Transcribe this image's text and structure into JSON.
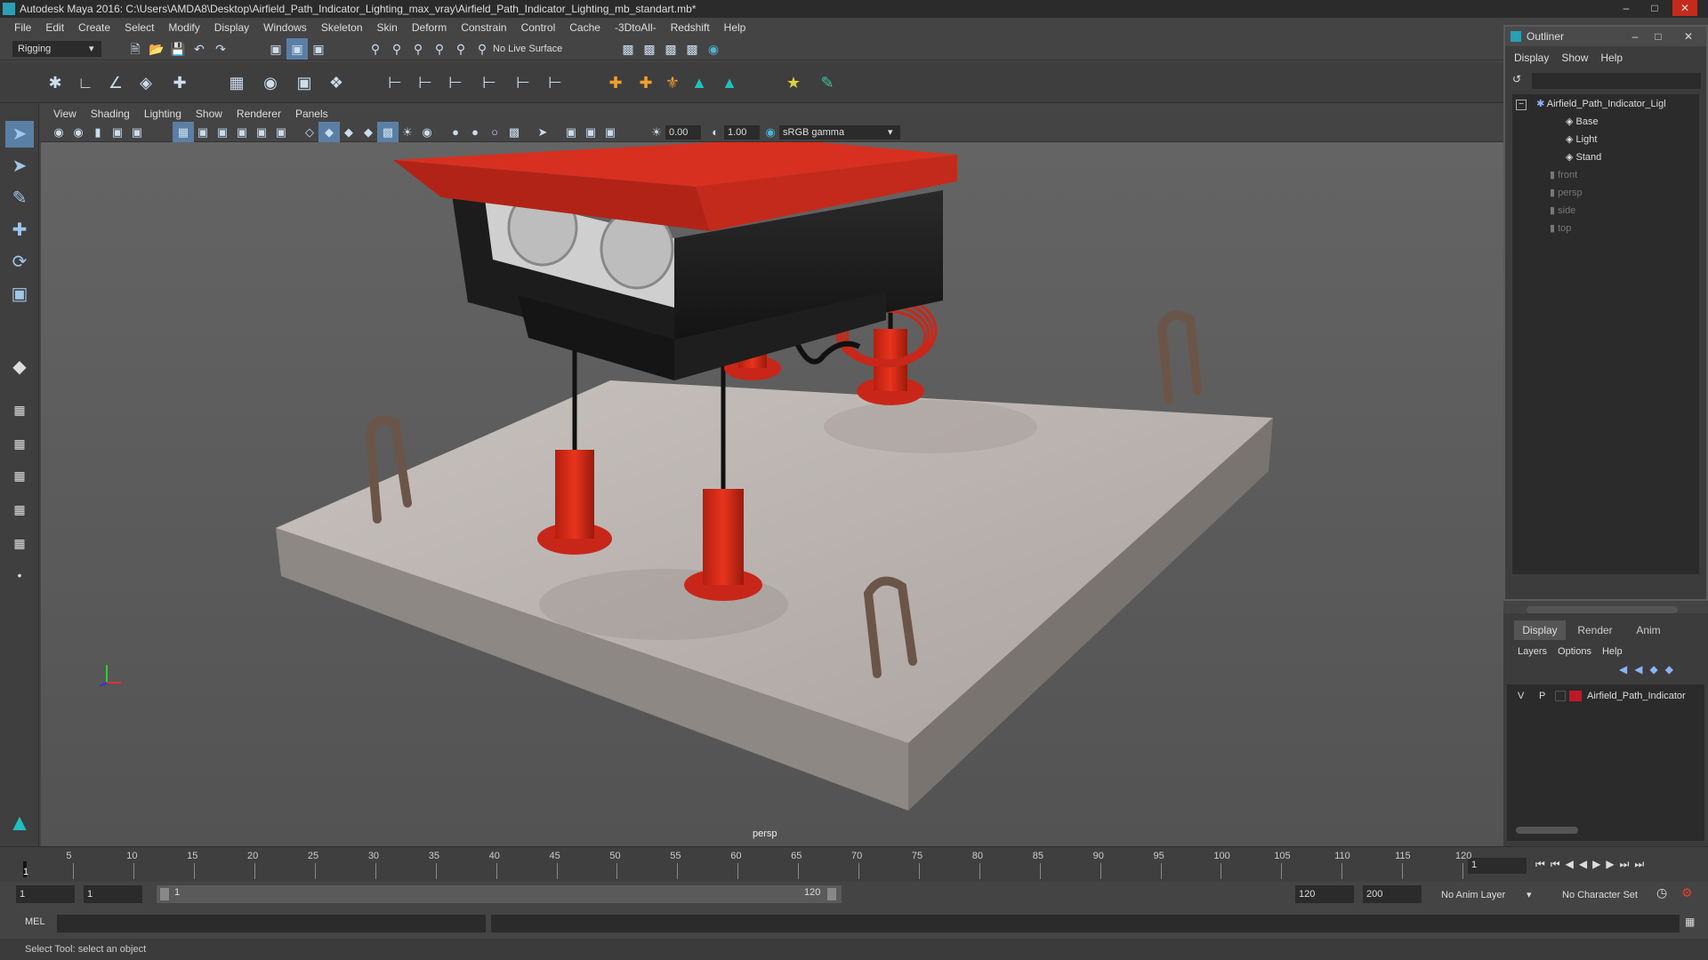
{
  "window": {
    "title": "Autodesk Maya 2016: C:\\Users\\AMDA8\\Desktop\\Airfield_Path_Indicator_Lighting_max_vray\\Airfield_Path_Indicator_Lighting_mb_standart.mb*"
  },
  "menubar": [
    "File",
    "Edit",
    "Create",
    "Select",
    "Modify",
    "Display",
    "Windows",
    "Skeleton",
    "Skin",
    "Deform",
    "Constrain",
    "Control",
    "Cache",
    "-3DtoAll-",
    "Redshift",
    "Help"
  ],
  "statusline": {
    "menu_set": "Rigging",
    "live_surface": "No Live Surface"
  },
  "panel": {
    "menus": [
      "View",
      "Shading",
      "Lighting",
      "Show",
      "Renderer",
      "Panels"
    ],
    "exposure": "0.00",
    "gamma": "1.00",
    "color_space": "sRGB gamma",
    "camera_label": "persp"
  },
  "outliner": {
    "title": "Outliner",
    "menus": [
      "Display",
      "Show",
      "Help"
    ],
    "items": [
      {
        "label": "Airfield_Path_Indicator_Ligl",
        "dim": false
      },
      {
        "label": "Base",
        "dim": false
      },
      {
        "label": "Light",
        "dim": false
      },
      {
        "label": "Stand",
        "dim": false
      },
      {
        "label": "front",
        "dim": true
      },
      {
        "label": "persp",
        "dim": true
      },
      {
        "label": "side",
        "dim": true
      },
      {
        "label": "top",
        "dim": true
      }
    ]
  },
  "layers": {
    "tabs": [
      "Display",
      "Render",
      "Anim"
    ],
    "menus": [
      "Layers",
      "Options",
      "Help"
    ],
    "row": {
      "v": "V",
      "p": "P",
      "name": "Airfield_Path_Indicator",
      "color": "#c0182a"
    }
  },
  "timeline": {
    "ticks": [
      "5",
      "10",
      "15",
      "20",
      "25",
      "30",
      "35",
      "40",
      "45",
      "50",
      "55",
      "60",
      "65",
      "70",
      "75",
      "80",
      "85",
      "90",
      "95",
      "100",
      "105",
      "110",
      "115",
      "120"
    ],
    "start_marker": "1",
    "current_frame": "1"
  },
  "range": {
    "start": "1",
    "inner_start": "1",
    "slider_start": "1",
    "slider_end": "120",
    "end": "120",
    "max_end": "200",
    "anim_layer": "No Anim Layer",
    "char_set": "No Character Set"
  },
  "cmdline": {
    "label": "MEL"
  },
  "helpline": {
    "text": "Select Tool: select an object"
  },
  "colors": {
    "accent": "#2a9fb5",
    "model_red": "#d02a16",
    "concrete": "#b8b2ae"
  }
}
